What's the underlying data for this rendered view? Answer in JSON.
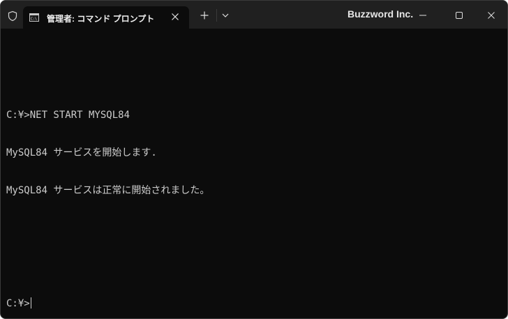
{
  "window": {
    "brand": "Buzzword Inc."
  },
  "tab": {
    "title": "管理者: コマンド プロンプト",
    "icon": "cmd-icon"
  },
  "titlebar": {
    "shield_icon": "shield-icon",
    "new_tab_icon": "plus-icon",
    "dropdown_icon": "chevron-down-icon",
    "minimize_icon": "minimize-icon",
    "maximize_icon": "maximize-icon",
    "close_icon": "close-icon"
  },
  "terminal": {
    "lines": [
      "",
      "C:¥>NET START MYSQL84",
      "MySQL84 サービスを開始します.",
      "MySQL84 サービスは正常に開始されました。",
      "",
      "",
      "C:¥>"
    ]
  },
  "colors": {
    "titlebar_bg": "#202020",
    "terminal_bg": "#0c0c0c",
    "terminal_fg": "#cccccc"
  }
}
